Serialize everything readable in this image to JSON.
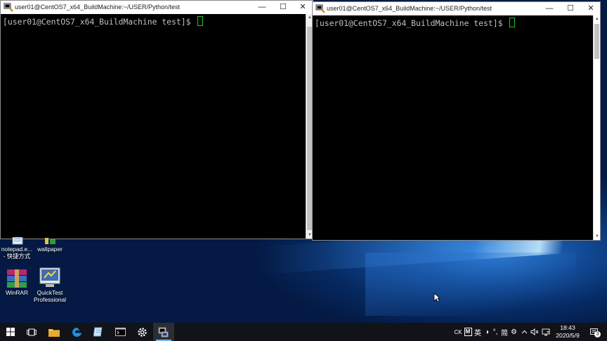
{
  "window_left": {
    "title": "user01@CentOS7_x64_BuildMachine:~/USER/Python/test",
    "prompt": "[user01@CentOS7_x64_BuildMachine test]$ "
  },
  "window_right": {
    "title": "user01@CentOS7_x64_BuildMachine:~/USER/Python/test",
    "prompt": "[user01@CentOS7_x64_BuildMachine test]$ "
  },
  "window_controls": {
    "minimize": "—",
    "maximize": "☐",
    "close": "✕"
  },
  "desktop_icons": [
    {
      "label_line1": "notepad.e...",
      "label_line2": "- 快捷方式",
      "icon": "notepad-shortcut-icon"
    },
    {
      "label_line1": "wallpaper",
      "label_line2": "",
      "icon": "wallpaper-icon"
    },
    {
      "label_line1": "WinRAR",
      "label_line2": "",
      "icon": "winrar-icon"
    },
    {
      "label_line1": "QuickTest",
      "label_line2": "Professional",
      "icon": "quicktest-icon"
    }
  ],
  "taskbar": {
    "pinned": [
      "windows-start-icon",
      "task-view-icon",
      "file-explorer-icon",
      "edge-icon",
      "notepad-icon",
      "terminal-icon",
      "settings-icon",
      "putty-icon"
    ],
    "tray": {
      "lang": "CK",
      "ime_mode": "英",
      "ime_script": "简",
      "time": "18:43",
      "date": "2020/5/9",
      "notifications": "3"
    }
  }
}
